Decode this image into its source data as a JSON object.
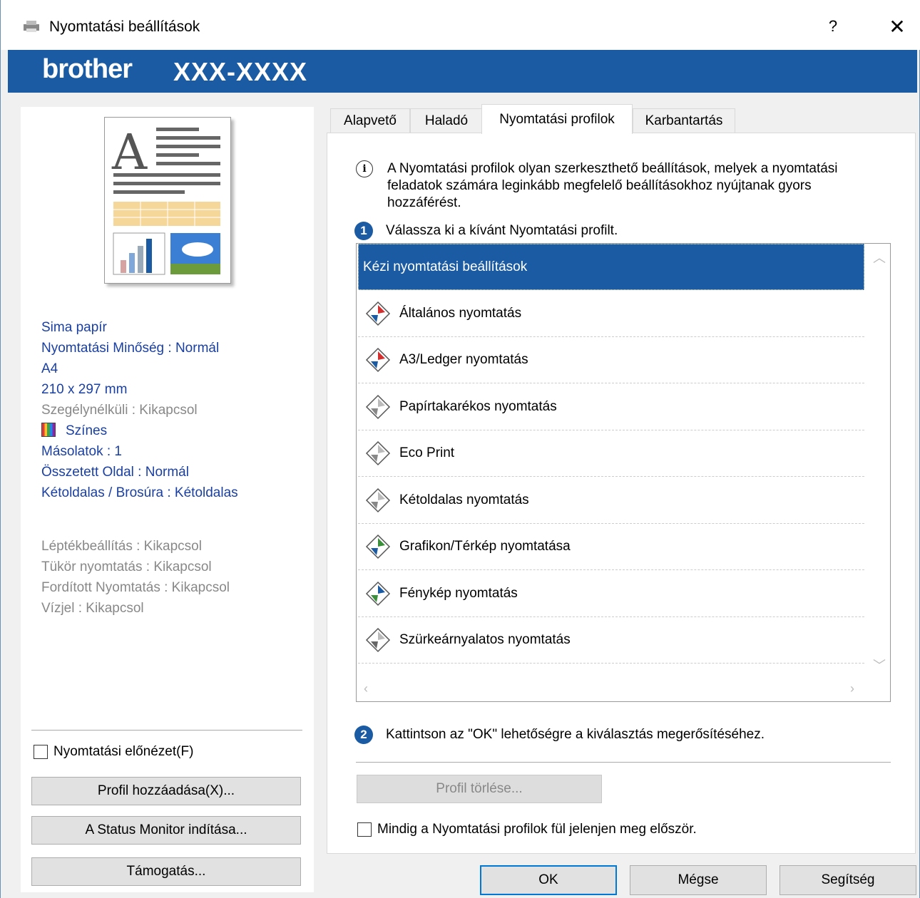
{
  "window": {
    "title": "Nyomtatási beállítások",
    "help": "?",
    "close": "✕"
  },
  "brand": {
    "logo": "brother",
    "model": "XXX-XXXX"
  },
  "left": {
    "settings": [
      {
        "text": "Sima papír",
        "style": "blue"
      },
      {
        "text": "Nyomtatási Minőség : Normál",
        "style": "blue"
      },
      {
        "text": "A4",
        "style": "blue"
      },
      {
        "text": "210 x 297 mm",
        "style": "blue"
      },
      {
        "text": "Szegélynélküli : Kikapcsol",
        "style": "gray"
      },
      {
        "text": "Színes",
        "style": "color"
      },
      {
        "text": "Másolatok : 1",
        "style": "blue"
      },
      {
        "text": "Összetett Oldal : Normál",
        "style": "blue"
      },
      {
        "text": "Kétoldalas / Brosúra : Kétoldalas",
        "style": "blue"
      }
    ],
    "settings2": [
      "Léptékbeállítás : Kikapcsol",
      "Tükör nyomtatás : Kikapcsol",
      "Fordított Nyomtatás : Kikapcsol",
      "Vízjel : Kikapcsol"
    ],
    "preview_checkbox": "Nyomtatási előnézet(F)",
    "add_profile": "Profil hozzáadása(X)...",
    "status_monitor": "A Status Monitor indítása...",
    "support": "Támogatás..."
  },
  "tabs": [
    "Alapvető",
    "Haladó",
    "Nyomtatási profilok",
    "Karbantartás"
  ],
  "profiles": {
    "info": "A Nyomtatási profilok olyan szerkeszthető beállítások, melyek a nyomtatási feladatok számára leginkább megfelelő beállításokhoz nyújtanak gyors hozzáférést.",
    "step1": "Válassza ki a kívánt Nyomtatási profilt.",
    "step1_num": "1",
    "items": [
      "Kézi nyomtatási beállítások",
      "Általános nyomtatás",
      "A3/Ledger nyomtatás",
      "Papírtakarékos nyomtatás",
      "Eco Print",
      "Kétoldalas nyomtatás",
      "Grafikon/Térkép nyomtatása",
      "Fénykép nyomtatás",
      "Szürkeárnyalatos nyomtatás"
    ],
    "selected_index": 0,
    "step2": "Kattintson az \"OK\" lehetőségre a kiválasztás megerősítéséhez.",
    "step2_num": "2",
    "delete_profile": "Profil törlése...",
    "always_show": "Mindig a Nyomtatási profilok fül jelenjen meg először."
  },
  "footer": {
    "ok": "OK",
    "cancel": "Mégse",
    "help": "Segítség"
  },
  "colors": {
    "accent": "#1a5ba3",
    "setting_text": "#1a3fa3"
  }
}
